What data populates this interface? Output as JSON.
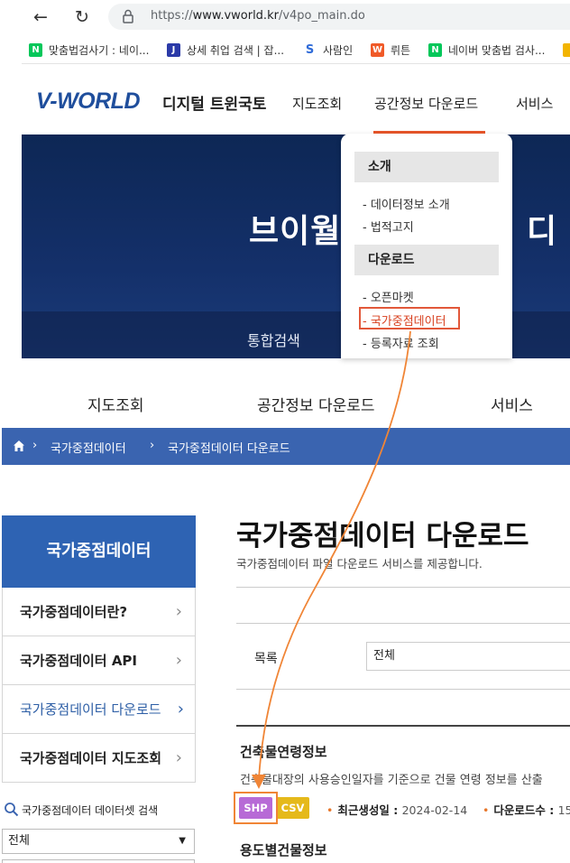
{
  "browser": {
    "back_icon": "arrow-left",
    "reload_icon": "reload",
    "url_prefix": "https://",
    "url_host": "www.vworld.kr",
    "url_path": "/v4po_main.do",
    "bookmarks": [
      {
        "icon": "N",
        "color": "#03c75a",
        "label": "맞춤법검사기 : 네이..."
      },
      {
        "icon": "J",
        "color": "#2b3aa8",
        "label": "상세 취업 검색 | 잡..."
      },
      {
        "icon": "S",
        "color": "#ffffff",
        "label": "사람인"
      },
      {
        "icon": "W",
        "color": "#f05a28",
        "label": "뤼튼"
      },
      {
        "icon": "N",
        "color": "#03c75a",
        "label": "네이버 맞춤법 검사..."
      }
    ]
  },
  "vworld": {
    "logo": "V-WORLD",
    "logo_sub": "디지털 트윈국토",
    "gnb": [
      "지도조회",
      "공간정보 다운로드",
      "서비스"
    ],
    "banner_title": "브이월",
    "banner_title_tail": "디",
    "banner_search": "통합검색",
    "dropdown": {
      "intro_header": "소개",
      "intro_items": [
        "- 데이터정보 소개",
        "- 법적고지"
      ],
      "download_header": "다운로드",
      "download_items": [
        "- 오픈마켓",
        "- 국가중점데이터",
        "- 등록자료 조회"
      ]
    }
  },
  "page": {
    "gnb": [
      "지도조회",
      "공간정보 다운로드",
      "서비스"
    ],
    "breadcrumb": [
      "국가중점데이터",
      "국가중점데이터 다운로드"
    ],
    "sidebar": {
      "header": "국가중점데이터",
      "items": [
        "국가중점데이터란?",
        "국가중점데이터 API",
        "국가중점데이터 다운로드",
        "국가중점데이터 지도조회"
      ],
      "dataset_search_label": "국가중점데이터 데이터셋 검색",
      "dataset_select_value": "전체"
    },
    "main": {
      "title": "국가중점데이터 다운로드",
      "description": "국가중점데이터 파일 다운로드 서비스를 제공합니다.",
      "filter_label": "목록",
      "filter_value": "전체",
      "items": [
        {
          "title": "건축물연령정보",
          "description": "건축물대장의 사용승인일자를 기준으로 건물 연령 정보를 산출",
          "formats": [
            "SHP",
            "CSV"
          ],
          "updated_label": "최근생성일 : ",
          "updated_value": "2024-02-14",
          "downloads_label": "다운로드수 : ",
          "downloads_value": "15"
        },
        {
          "title": "용도별건물정보"
        }
      ]
    }
  },
  "annotation": {
    "highlight_color": "#f08536"
  }
}
